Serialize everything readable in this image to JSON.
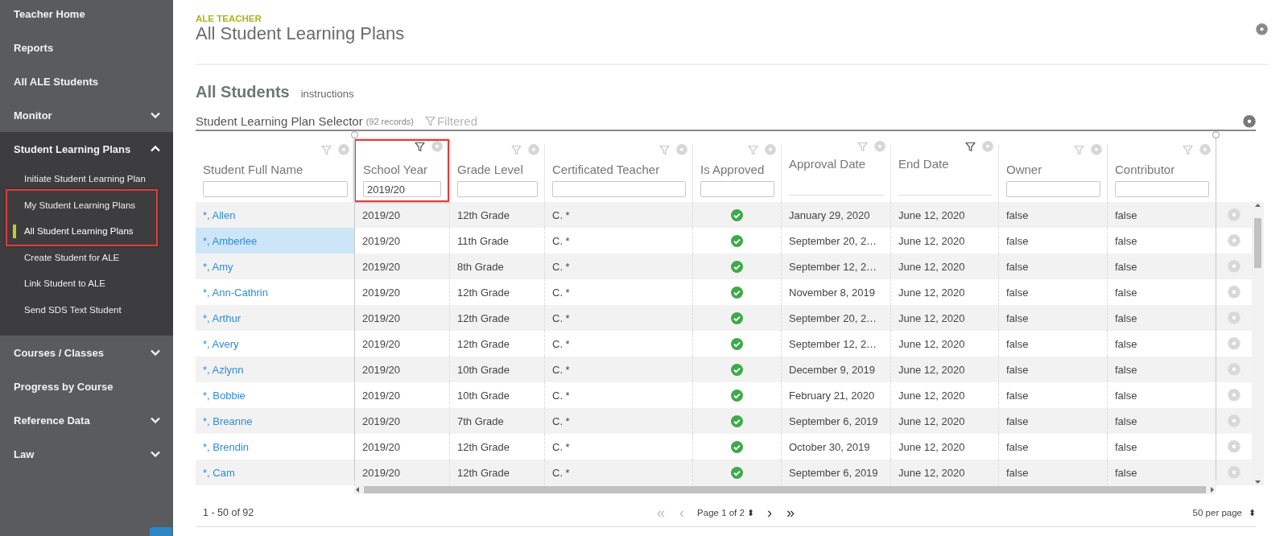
{
  "sidebar": {
    "items": [
      {
        "label": "Teacher Home"
      },
      {
        "label": "Reports"
      },
      {
        "label": "All ALE Students"
      },
      {
        "label": "Monitor",
        "expanded": false
      },
      {
        "label": "Student Learning Plans",
        "expanded": true,
        "children": [
          {
            "label": "Initiate Student Learning Plan",
            "selected": false,
            "highlighted": false
          },
          {
            "label": "My Student Learning Plans",
            "selected": false,
            "highlighted": true
          },
          {
            "label": "All Student Learning Plans",
            "selected": true,
            "highlighted": true
          },
          {
            "label": "Create Student for ALE",
            "selected": false,
            "highlighted": false
          },
          {
            "label": "Link Student to ALE",
            "selected": false,
            "highlighted": false
          },
          {
            "label": "Send SDS Text Student",
            "selected": false,
            "highlighted": false
          }
        ]
      },
      {
        "label": "Courses / Classes",
        "expanded": false
      },
      {
        "label": "Progress by Course"
      },
      {
        "label": "Reference Data",
        "expanded": false
      },
      {
        "label": "Law",
        "expanded": false
      }
    ]
  },
  "header": {
    "eyebrow": "ALE TEACHER",
    "title": "All Student Learning Plans"
  },
  "section": {
    "title": "All Students",
    "link": "instructions"
  },
  "selector": {
    "title": "Student Learning Plan Selector",
    "count": "(92 records)",
    "filter_status": "Filtered"
  },
  "table": {
    "columns": [
      {
        "label": "Student Full Name",
        "filtered": false,
        "filter_field": true,
        "highlighted": false
      },
      {
        "label": "School Year",
        "filtered": true,
        "filter_field": true,
        "filter_value": "2019/20",
        "highlighted": true
      },
      {
        "label": "Grade Level",
        "filtered": false,
        "filter_field": true,
        "highlighted": false
      },
      {
        "label": "Certificated Teacher",
        "filtered": false,
        "filter_field": true,
        "highlighted": false
      },
      {
        "label": "Is Approved",
        "filtered": false,
        "filter_field": true,
        "highlighted": false
      },
      {
        "label": "Approval Date",
        "filtered": false,
        "filter_field": false,
        "highlighted": false
      },
      {
        "label": "End Date",
        "filtered": true,
        "filter_field": false,
        "highlighted": false
      },
      {
        "label": "Owner",
        "filtered": false,
        "filter_field": true,
        "highlighted": false
      },
      {
        "label": "Contributor",
        "filtered": false,
        "filter_field": true,
        "highlighted": false
      }
    ],
    "rows": [
      {
        "name": "*, Allen",
        "year": "2019/20",
        "grade": "12th Grade",
        "teacher": "C. *",
        "approved": true,
        "approval_date": "January 29, 2020",
        "end_date": "June 12, 2020",
        "owner": "false",
        "contributor": "false",
        "selected": false
      },
      {
        "name": "*, Amberlee",
        "year": "2019/20",
        "grade": "11th Grade",
        "teacher": "C. *",
        "approved": true,
        "approval_date": "September 20, 2…",
        "end_date": "June 12, 2020",
        "owner": "false",
        "contributor": "false",
        "selected": true
      },
      {
        "name": "*, Amy",
        "year": "2019/20",
        "grade": "8th Grade",
        "teacher": "C. *",
        "approved": true,
        "approval_date": "September 12, 2…",
        "end_date": "June 12, 2020",
        "owner": "false",
        "contributor": "false",
        "selected": false
      },
      {
        "name": "*, Ann-Cathrin",
        "year": "2019/20",
        "grade": "12th Grade",
        "teacher": "C. *",
        "approved": true,
        "approval_date": "November 8, 2019",
        "end_date": "June 12, 2020",
        "owner": "false",
        "contributor": "false",
        "selected": false
      },
      {
        "name": "*, Arthur",
        "year": "2019/20",
        "grade": "12th Grade",
        "teacher": "C. *",
        "approved": true,
        "approval_date": "September 20, 2…",
        "end_date": "June 12, 2020",
        "owner": "false",
        "contributor": "false",
        "selected": false
      },
      {
        "name": "*, Avery",
        "year": "2019/20",
        "grade": "12th Grade",
        "teacher": "C. *",
        "approved": true,
        "approval_date": "September 12, 2…",
        "end_date": "June 12, 2020",
        "owner": "false",
        "contributor": "false",
        "selected": false
      },
      {
        "name": "*, Azlynn",
        "year": "2019/20",
        "grade": "10th Grade",
        "teacher": "C. *",
        "approved": true,
        "approval_date": "December 9, 2019",
        "end_date": "June 12, 2020",
        "owner": "false",
        "contributor": "false",
        "selected": false
      },
      {
        "name": "*, Bobbie",
        "year": "2019/20",
        "grade": "10th Grade",
        "teacher": "C. *",
        "approved": true,
        "approval_date": "February 21, 2020",
        "end_date": "June 12, 2020",
        "owner": "false",
        "contributor": "false",
        "selected": false
      },
      {
        "name": "*, Breanne",
        "year": "2019/20",
        "grade": "7th Grade",
        "teacher": "C. *",
        "approved": true,
        "approval_date": "September 6, 2019",
        "end_date": "June 12, 2020",
        "owner": "false",
        "contributor": "false",
        "selected": false
      },
      {
        "name": "*, Brendin",
        "year": "2019/20",
        "grade": "12th Grade",
        "teacher": "C. *",
        "approved": true,
        "approval_date": "October 30, 2019",
        "end_date": "June 12, 2020",
        "owner": "false",
        "contributor": "false",
        "selected": false
      },
      {
        "name": "*, Cam",
        "year": "2019/20",
        "grade": "12th Grade",
        "teacher": "C. *",
        "approved": true,
        "approval_date": "September 6, 2019",
        "end_date": "June 12, 2020",
        "owner": "false",
        "contributor": "false",
        "selected": false
      }
    ]
  },
  "pager": {
    "range": "1 - 50 of 92",
    "buttons": [
      {
        "glyph": "«",
        "disabled": true
      },
      {
        "glyph": "‹",
        "disabled": true
      }
    ],
    "page": "Page 1 of 2",
    "page_glyph": "⬍",
    "next_buttons": [
      {
        "glyph": "›",
        "disabled": false
      },
      {
        "glyph": "»",
        "disabled": false
      }
    ],
    "per_page": "50 per page",
    "per_page_glyph": "⬍"
  }
}
